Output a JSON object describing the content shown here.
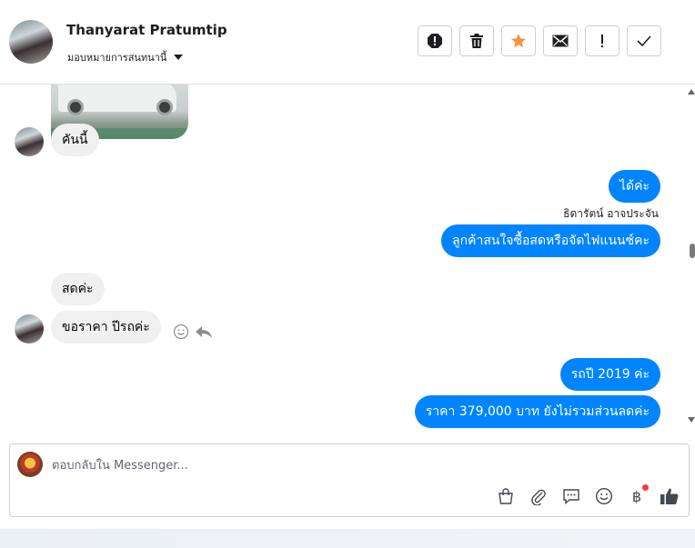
{
  "header": {
    "contact_name": "Thanyarat Pratumtip",
    "assign_label": "มอบหมายการสนทนานี้",
    "toolbar_icons": [
      "spam-icon",
      "trash-icon",
      "star-icon",
      "envelope-icon",
      "exclamation-icon",
      "check-icon"
    ],
    "star_color": "#f7923b"
  },
  "chat": {
    "messages": [
      {
        "from": "customer",
        "text": "คันนี้"
      },
      {
        "from": "page",
        "text": "ได้ค่ะ"
      },
      {
        "from": "page",
        "text": "ลูกค้าสนใจซื้อสดหรือจัดไฟแนนซ์คะ"
      },
      {
        "from": "customer",
        "text": "สดค่ะ"
      },
      {
        "from": "customer",
        "text": "ขอราคา ปีรถค่ะ"
      },
      {
        "from": "page",
        "text": "รถปี 2019 ค่ะ"
      },
      {
        "from": "page",
        "text": "ราคา 379,000 บาท ยังไม่รวมส่วนลดค่ะ"
      }
    ],
    "sender_label": "ธิดารัตน์ อาจประจัน",
    "outgoing_color": "#0084ff",
    "incoming_color": "#f0f0f0"
  },
  "composer": {
    "placeholder": "ตอบกลับใน Messenger...",
    "value": "",
    "tool_icons": [
      "bag-icon",
      "paperclip-icon",
      "saved-reply-icon",
      "emoji-icon",
      "baht-icon",
      "like-icon"
    ],
    "baht_symbol": "฿"
  }
}
